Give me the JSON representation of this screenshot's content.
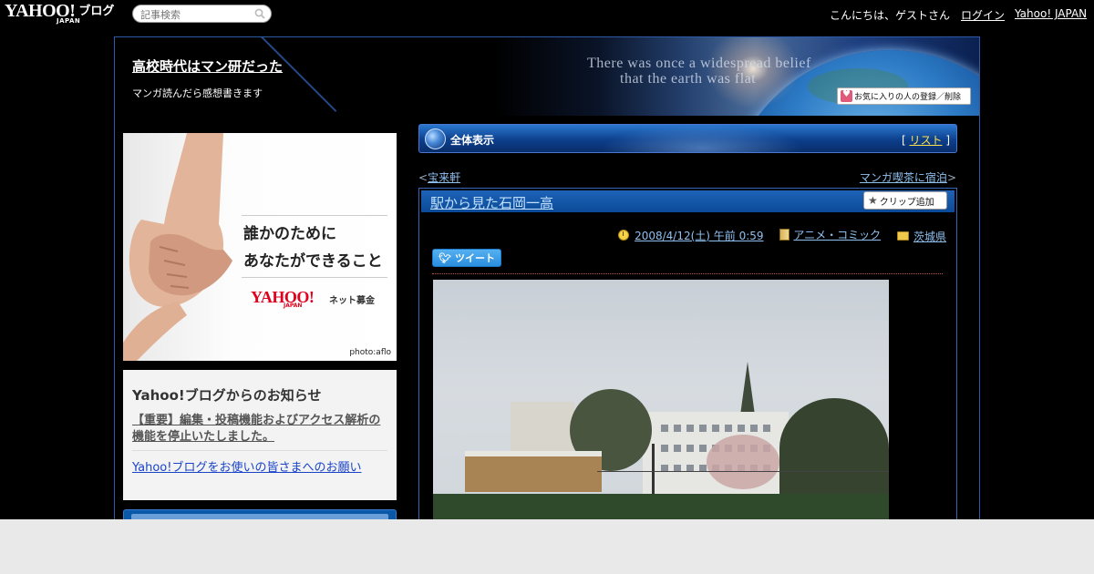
{
  "topbar": {
    "logo_main": "YAHOO!",
    "logo_sub": "JAPAN",
    "logo_service": "ブログ",
    "search_placeholder": "記事検索",
    "greeting": "こんにちは、ゲストさん",
    "login": "ログイン",
    "yahoo_japan": "Yahoo! JAPAN"
  },
  "header": {
    "title": "高校時代はマン研だった",
    "description": "マンガ読んだら感想書きます",
    "tagline_line1": "There was once a widespread belief",
    "tagline_line2": "that the earth was flat",
    "fav_button": "お気に入りの人の登録／削除"
  },
  "ad": {
    "line1": "誰かのために",
    "line2": "あなたができること",
    "logo_main": "YAHOO!",
    "logo_sub": "JAPAN",
    "logo_text": "ネット募金",
    "photo_credit": "photo:aflo"
  },
  "notice": {
    "title": "Yahoo!ブログからのお知らせ",
    "link1": "【重要】編集・投稿機能およびアクセス解析の機能を停止いたしました。",
    "link2": "Yahoo!ブログをお使いの皆さまへのお願い"
  },
  "viewbar": {
    "label": "全体表示",
    "bracket_open": "[",
    "list": "リスト",
    "bracket_close": "]"
  },
  "nav": {
    "prev_arrow": "<",
    "prev": "宝来軒",
    "next": "マンガ喫茶に宿泊",
    "next_arrow": ">"
  },
  "article": {
    "title": "駅から見た石岡一高",
    "clip_button": "クリップ追加",
    "date": "2008/4/12(土) 午前 0:59",
    "category": "アニメ・コミック",
    "folder": "茨城県",
    "tweet": "ツイート"
  }
}
